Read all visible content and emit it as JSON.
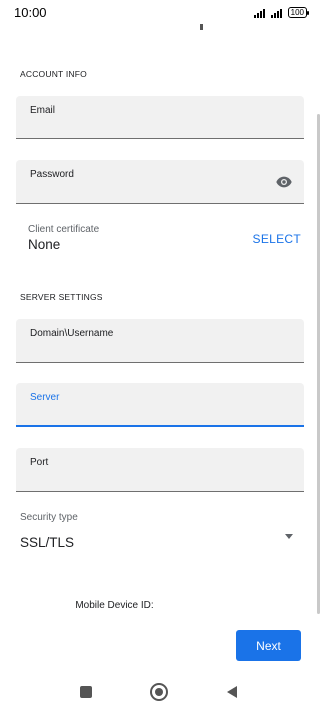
{
  "status_bar": {
    "time": "10:00",
    "battery": "100"
  },
  "account_info": {
    "section_title": "ACCOUNT INFO",
    "email_label": "Email",
    "password_label": "Password"
  },
  "client_certificate": {
    "label": "Client certificate",
    "value": "None",
    "select_label": "SELECT"
  },
  "server_settings": {
    "section_title": "SERVER SETTINGS",
    "domain_username_label": "Domain\\Username",
    "server_label": "Server",
    "port_label": "Port",
    "security_type_label": "Security type",
    "security_type_value": "SSL/TLS"
  },
  "device": {
    "mobile_device_id_label": "Mobile Device ID:"
  },
  "actions": {
    "next_label": "Next"
  }
}
